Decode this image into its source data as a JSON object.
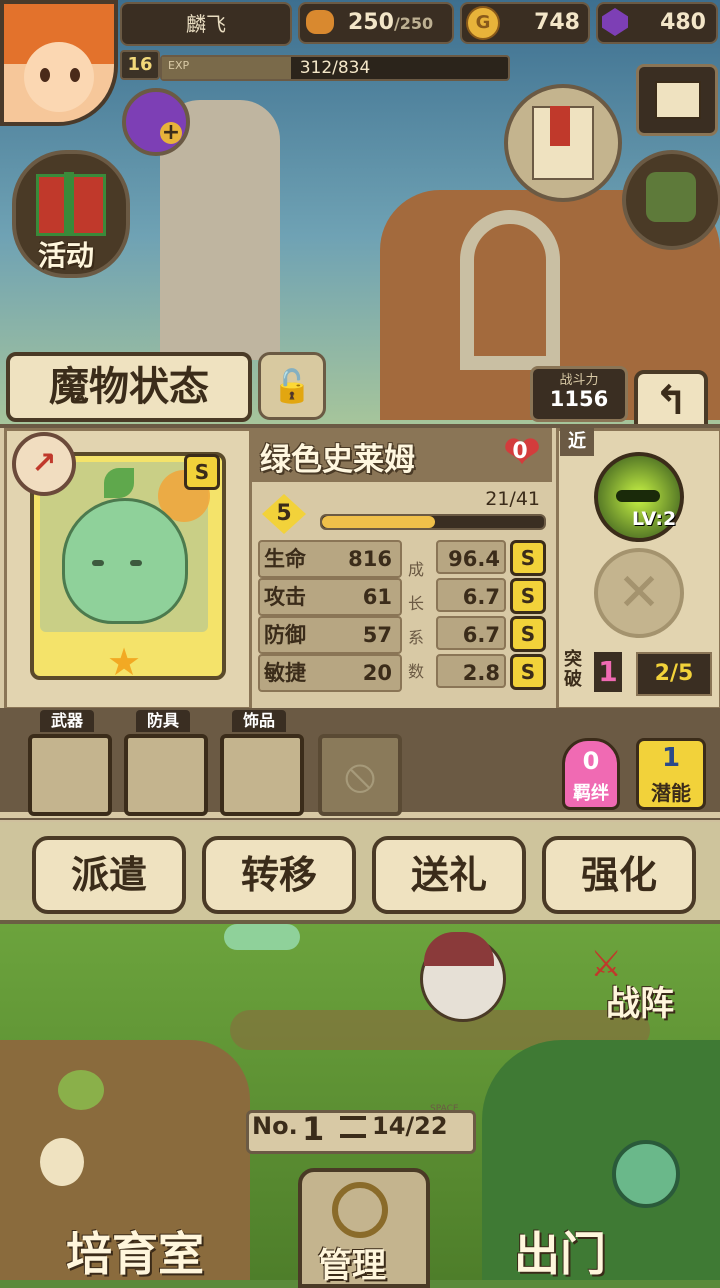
{
  "player": {
    "name": "麟飞",
    "level": "16",
    "exp_label": "EXP",
    "exp_text": "312/834",
    "exp_fraction": 0.374
  },
  "resources": {
    "stamina": "250",
    "stamina_max": "/250",
    "gold": "748",
    "gems": "480"
  },
  "left_menu": {
    "event_label": "活动"
  },
  "header": {
    "title": "魔物状态",
    "power_label": "战斗力",
    "power_value": "1156"
  },
  "monster": {
    "name": "绿色史莱姆",
    "affection": "0",
    "grade": "S",
    "level": "5",
    "exp_text": "21/41",
    "exp_fraction": 0.51,
    "stats": [
      {
        "label": "生命",
        "value": "816",
        "growth": "96.4",
        "grade": "S"
      },
      {
        "label": "攻击",
        "value": "61",
        "growth": "6.7",
        "grade": "S"
      },
      {
        "label": "防御",
        "value": "57",
        "growth": "6.7",
        "grade": "S"
      },
      {
        "label": "敏捷",
        "value": "20",
        "growth": "2.8",
        "grade": "S"
      }
    ],
    "growth_label": [
      "成",
      "长",
      "系",
      "数"
    ]
  },
  "skills": {
    "range": "近",
    "skill_level": "LV:2"
  },
  "breakthrough": {
    "label": "突破",
    "value": "1",
    "count": "2/5"
  },
  "equipment": {
    "weapon": "武器",
    "armor": "防具",
    "accessory": "饰品"
  },
  "bond": {
    "value": "0",
    "label": "羁绊"
  },
  "potential": {
    "value": "1",
    "label": "潜能"
  },
  "actions": {
    "dispatch": "派遣",
    "transfer": "转移",
    "gift": "送礼",
    "enhance": "强化"
  },
  "bottom": {
    "formation": "战阵",
    "no_label": "No.",
    "no_value": "1",
    "space_label": "SPACE",
    "space_value": "14/22",
    "nursery": "培育室",
    "manage": "管理",
    "go_out": "出门"
  },
  "colors": {
    "stamina_icon": "#d9892f",
    "gold_icon": "#e8b33a",
    "gem_icon": "#7d3fb5"
  }
}
